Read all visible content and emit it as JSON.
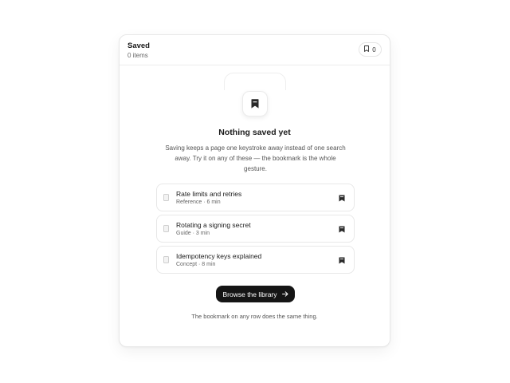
{
  "header": {
    "title": "Saved",
    "count_label": "0 items",
    "chip_icon": "bookmark-icon",
    "chip_count": "0"
  },
  "empty_state": {
    "icon": "bookmark-icon",
    "title": "Nothing saved yet",
    "description": "Saving keeps a page one keystroke away instead of one search away. Try it on any of these — the bookmark is the whole gesture."
  },
  "suggestions": [
    {
      "title": "Rate limits and retries",
      "meta": "Reference · 6 min",
      "icon": "document-icon",
      "action_icon": "bookmark-icon"
    },
    {
      "title": "Rotating a signing secret",
      "meta": "Guide · 3 min",
      "icon": "document-icon",
      "action_icon": "bookmark-icon"
    },
    {
      "title": "Idempotency keys explained",
      "meta": "Concept · 8 min",
      "icon": "document-icon",
      "action_icon": "bookmark-icon"
    }
  ],
  "cta": {
    "label": "Browse the library",
    "icon": "arrow-right-icon"
  },
  "footer_note": "The bookmark on any row does the same thing.",
  "colors": {
    "primary_button": "#151515",
    "icon": "#2a2a2a",
    "muted_text": "#555555"
  }
}
